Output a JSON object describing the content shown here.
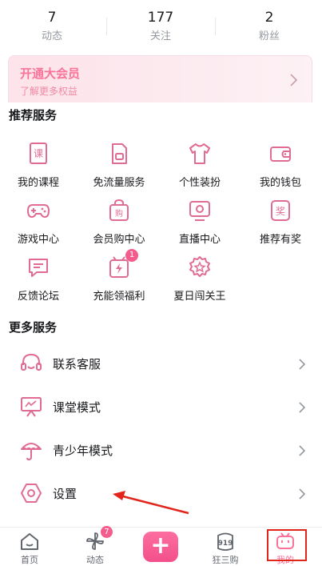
{
  "stats": [
    {
      "value": "7",
      "label": "动态"
    },
    {
      "value": "177",
      "label": "关注"
    },
    {
      "value": "2",
      "label": "粉丝"
    }
  ],
  "vip_banner": {
    "title": "开通大会员",
    "subtitle": "了解更多权益"
  },
  "recommended": {
    "title": "推荐服务",
    "items": [
      {
        "label": "我的课程",
        "icon": "course-book-icon"
      },
      {
        "label": "免流量服务",
        "icon": "sim-card-icon"
      },
      {
        "label": "个性装扮",
        "icon": "tshirt-icon"
      },
      {
        "label": "我的钱包",
        "icon": "wallet-icon"
      },
      {
        "label": "游戏中心",
        "icon": "gamepad-icon"
      },
      {
        "label": "会员购中心",
        "icon": "shopping-bag-icon"
      },
      {
        "label": "直播中心",
        "icon": "live-tv-icon"
      },
      {
        "label": "推荐有奖",
        "icon": "reward-badge-icon"
      },
      {
        "label": "反馈论坛",
        "icon": "chat-bubble-icon"
      },
      {
        "label": "充能领福利",
        "icon": "gift-bolt-icon",
        "badge": "1"
      },
      {
        "label": "夏日闯关王",
        "icon": "rosette-medal-icon"
      }
    ]
  },
  "more": {
    "title": "更多服务",
    "items": [
      {
        "label": "联系客服",
        "icon": "headset-icon"
      },
      {
        "label": "课堂模式",
        "icon": "classroom-board-icon"
      },
      {
        "label": "青少年模式",
        "icon": "umbrella-icon"
      },
      {
        "label": "设置",
        "icon": "settings-hexagon-icon"
      }
    ]
  },
  "tabbar": {
    "items": [
      {
        "label": "首页",
        "icon": "home-icon"
      },
      {
        "label": "动态",
        "icon": "pinwheel-icon",
        "badge": "7"
      },
      {
        "label": "狂三购",
        "icon": "shop-919-icon"
      },
      {
        "label": "我的",
        "icon": "tv-face-icon"
      }
    ],
    "plus": "+"
  },
  "colors": {
    "accent": "#fb7299",
    "icon_pink": "#e06c94",
    "annotation_red": "#e1251b"
  }
}
